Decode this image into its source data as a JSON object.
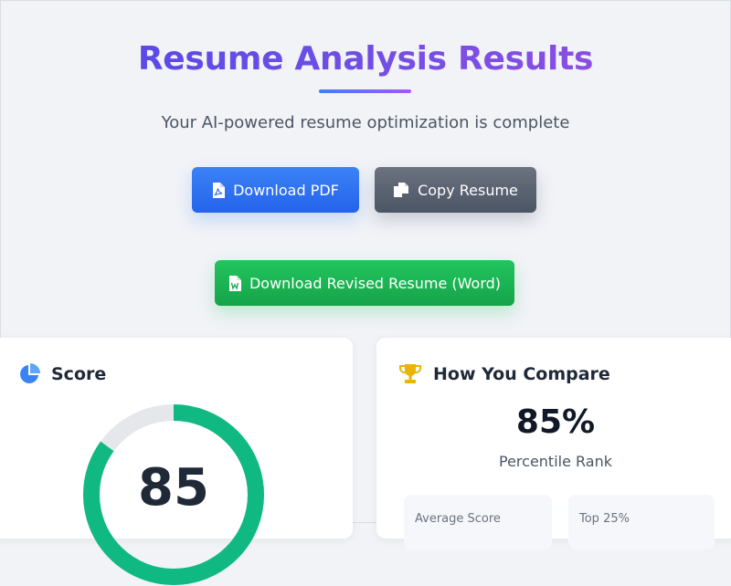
{
  "header": {
    "title": "Resume Analysis Results",
    "subtitle": "Your AI-powered resume optimization is complete"
  },
  "actions": {
    "download_pdf": "Download PDF",
    "copy_resume": "Copy Resume",
    "download_word": "Download Revised Resume (Word)"
  },
  "score_card": {
    "title": "Score",
    "value": "85",
    "progress_fraction": 0.85
  },
  "compare_card": {
    "title": "How You Compare",
    "percentile_value": "85%",
    "percentile_label": "Percentile Rank",
    "average_label": "Average Score",
    "top_label": "Top 25%"
  },
  "colors": {
    "accent_blue": "#3b82f6",
    "accent_purple": "#a855f7",
    "success_green": "#16a34a",
    "gauge_green": "#10b981",
    "gauge_track": "#e5e7eb",
    "trophy_gold": "#eab308"
  },
  "icons": {
    "pdf": "file-pdf-icon",
    "copy": "copy-icon",
    "word": "file-word-icon",
    "score": "pie-chart-icon",
    "compare": "trophy-icon"
  }
}
